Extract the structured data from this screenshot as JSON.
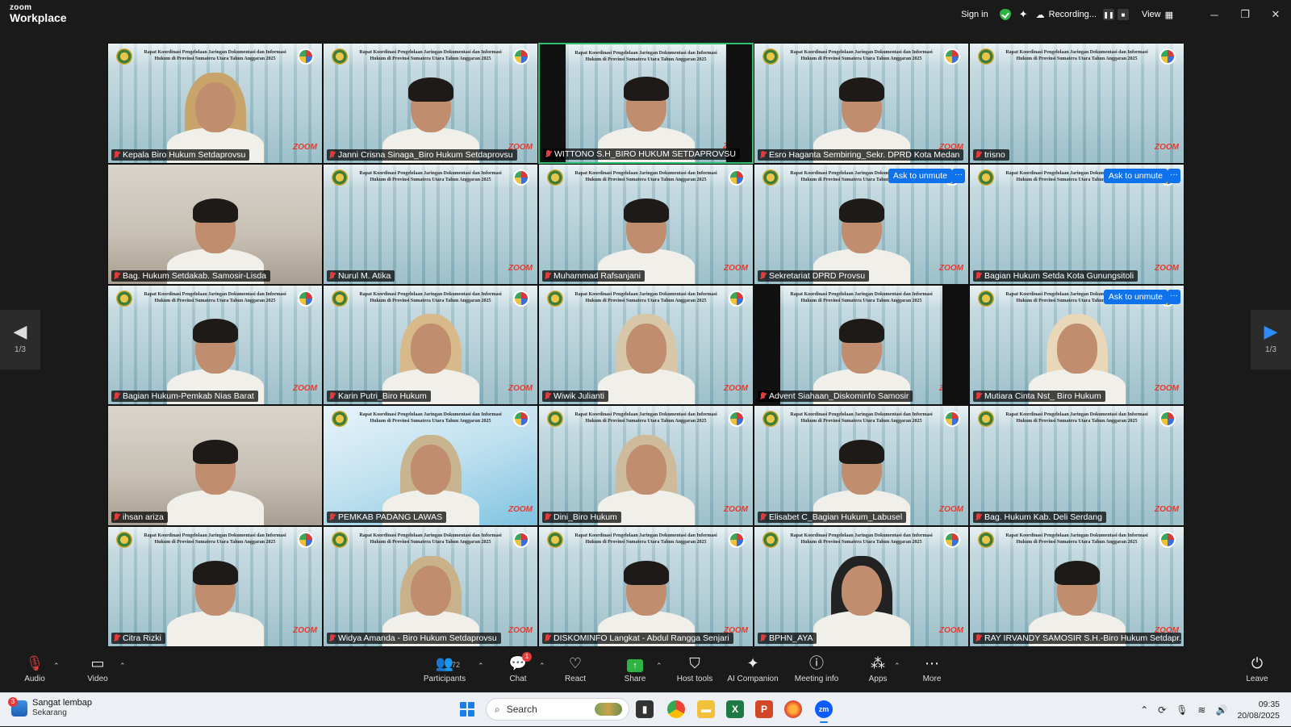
{
  "app": {
    "brand_small": "zoom",
    "brand_large": "Workplace"
  },
  "titlebar": {
    "signin": "Sign in",
    "recording": "Recording...",
    "view": "View",
    "min": "─",
    "restore": "❐",
    "close": "✕"
  },
  "tiles": [
    {
      "name": "Kepala Biro Hukum Setdaprovsu",
      "look": "hijab",
      "hijab_color": "#c9a46a",
      "bg": "office"
    },
    {
      "name": "Janni Crisna Sinaga_Biro Hukum Setdaprovsu",
      "look": "hair",
      "bg": "office"
    },
    {
      "name": "WITTONO S.H_BIRO HUKUM SETDAPROVSU",
      "look": "hair",
      "bg": "office",
      "active": true,
      "bars": true
    },
    {
      "name": "Esro Haganta Sembiring_Sekr. DPRD Kota Medan",
      "look": "hair",
      "bg": "office"
    },
    {
      "name": "trisno",
      "look": "none",
      "bg": "office"
    },
    {
      "name": "Bag. Hukum Setdakab. Samosir-Lisda",
      "look": "hair",
      "bg": "plain"
    },
    {
      "name": "Nurul M. Atika",
      "look": "none",
      "bg": "office"
    },
    {
      "name": "Muhammad Rafsanjani",
      "look": "hair",
      "bg": "office"
    },
    {
      "name": "Sekretariat DPRD Provsu",
      "look": "hair",
      "bg": "office",
      "unmute": true
    },
    {
      "name": "Bagian Hukum Setda Kota Gunungsitoli",
      "look": "none",
      "bg": "office",
      "unmute": true
    },
    {
      "name": "Bagian Hukum-Pemkab Nias Barat",
      "look": "hair",
      "bg": "office"
    },
    {
      "name": "Karin Putri_Biro Hukum",
      "look": "hijab",
      "hijab_color": "#d8b98a",
      "bg": "office"
    },
    {
      "name": "Wiwik Julianti",
      "look": "hijab",
      "hijab_color": "#d7c7a8",
      "bg": "office"
    },
    {
      "name": "Advent Siahaan_Diskominfo Samosir",
      "look": "hair",
      "bg": "office",
      "bars": true
    },
    {
      "name": "Mutiara Cinta Nst_ Biro Hukum",
      "look": "hijab",
      "hijab_color": "#e8d7b8",
      "bg": "office",
      "unmute": true
    },
    {
      "name": "ihsan ariza",
      "look": "hair",
      "bg": "plain"
    },
    {
      "name": "PEMKAB PADANG LAWAS",
      "look": "hijab",
      "hijab_color": "#c8b48f",
      "bg": "blur"
    },
    {
      "name": "Dini_Biro Hukum",
      "look": "hijab",
      "hijab_color": "#cdbb9c",
      "bg": "office"
    },
    {
      "name": "Elisabet C_Bagian Hukum_Labusel",
      "look": "hair",
      "bg": "office"
    },
    {
      "name": "Bag. Hukum Kab. Deli Serdang",
      "look": "none",
      "bg": "office"
    },
    {
      "name": "Citra Rizki",
      "look": "hair",
      "bg": "office"
    },
    {
      "name": "Widya Amanda - Biro Hukum Setdaprovsu",
      "look": "hijab",
      "hijab_color": "#c9b28a",
      "bg": "office"
    },
    {
      "name": "DISKOMINFO Langkat - Abdul Rangga Senjari",
      "look": "hair",
      "bg": "office"
    },
    {
      "name": "BPHN_AYA",
      "look": "hijab",
      "hijab_color": "#222222",
      "bg": "office"
    },
    {
      "name": "RAY IRVANDY SAMOSIR S.H.-Biro Hukum Setdapr...",
      "look": "hair",
      "bg": "office"
    }
  ],
  "tile_texts": {
    "banner": "Rapat Koordinasi Pengelolaan Jaringan Dokumentasi dan Informasi Hukum di Provinsi Sumatera Utara Tahun Anggaran 2025",
    "zoom_mark": "ZOOM",
    "ask_unmute": "Ask to unmute",
    "more": "···"
  },
  "pager": {
    "left": "1/3",
    "right": "1/3"
  },
  "toolbar": {
    "audio": "Audio",
    "video": "Video",
    "participants": "Participants",
    "participants_count": "72",
    "chat": "Chat",
    "chat_badge": "1",
    "react": "React",
    "share": "Share",
    "host_tools": "Host tools",
    "ai_companion": "AI Companion",
    "meeting_info": "Meeting info",
    "apps": "Apps",
    "more": "More",
    "leave": "Leave"
  },
  "taskbar": {
    "weather_badge": "3",
    "weather_title": "Sangat lembap",
    "weather_sub": "Sekarang",
    "search": "Search",
    "time": "09:35",
    "date": "20/08/2025"
  }
}
